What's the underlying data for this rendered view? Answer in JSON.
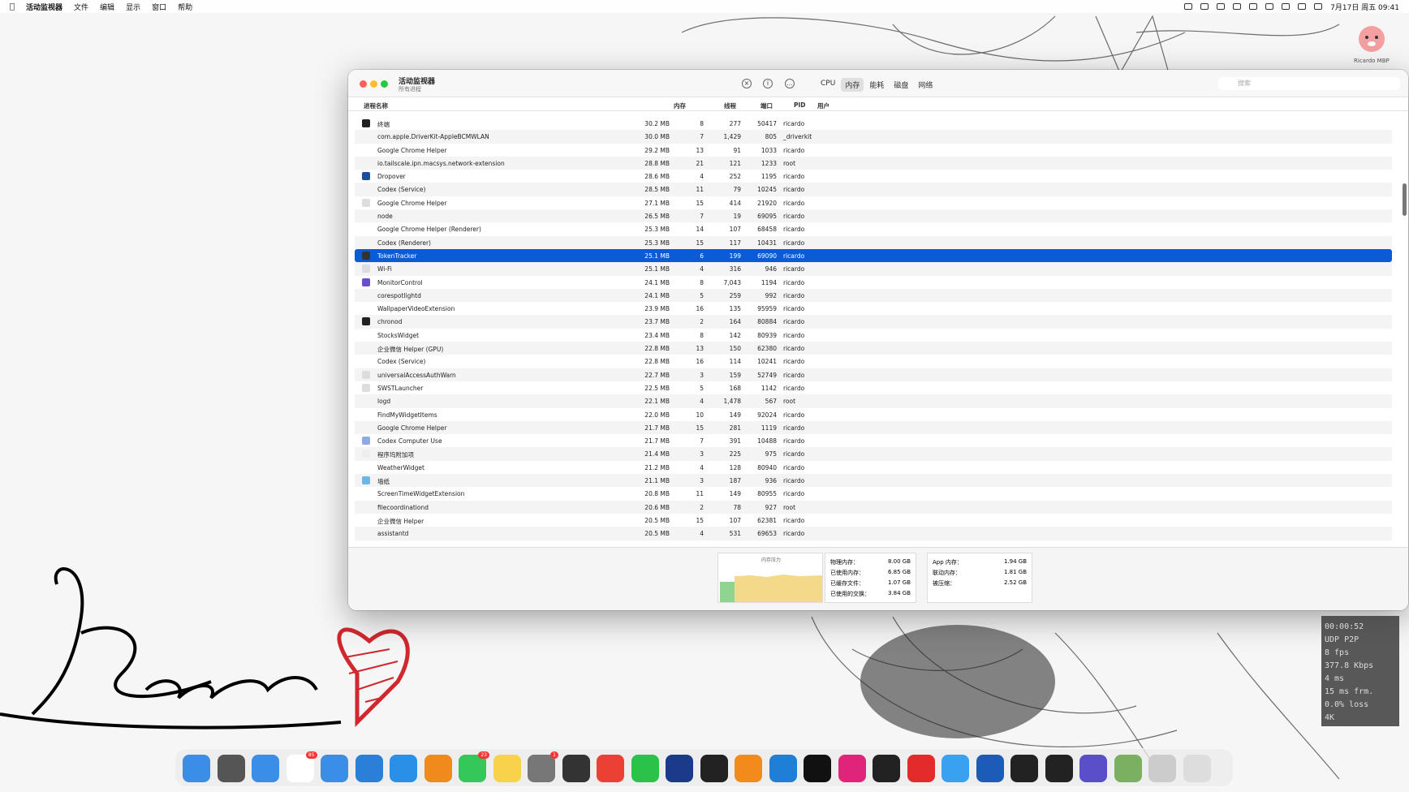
{
  "menubar": {
    "app_name": "活动监视器",
    "items": [
      "文件",
      "编辑",
      "显示",
      "窗口",
      "帮助"
    ],
    "datetime": "7月17日 周五 09:41"
  },
  "avatar_label": "Ricardo MBP",
  "window": {
    "title": "活动监视器",
    "subtitle": "所有进程",
    "tabs": [
      "CPU",
      "内存",
      "能耗",
      "磁盘",
      "网络"
    ],
    "active_tab": "内存",
    "search_placeholder": "搜索",
    "columns": {
      "name": "进程名称",
      "mem": "内存",
      "threads": "线程",
      "ports": "端口",
      "pid": "PID",
      "user": "用户"
    }
  },
  "rows": [
    {
      "name": "终端",
      "mem": "30.2 MB",
      "threads": "8",
      "ports": "277",
      "pid": "50417",
      "user": "ricardo",
      "icon": "#222"
    },
    {
      "name": "com.apple.DriverKit-AppleBCMWLAN",
      "mem": "30.0 MB",
      "threads": "7",
      "ports": "1,429",
      "pid": "805",
      "user": "_driverkit",
      "icon": ""
    },
    {
      "name": "Google Chrome Helper",
      "mem": "29.2 MB",
      "threads": "13",
      "ports": "91",
      "pid": "1033",
      "user": "ricardo",
      "icon": ""
    },
    {
      "name": "io.tailscale.ipn.macsys.network-extension",
      "mem": "28.8 MB",
      "threads": "21",
      "ports": "121",
      "pid": "1233",
      "user": "root",
      "icon": ""
    },
    {
      "name": "Dropover",
      "mem": "28.6 MB",
      "threads": "4",
      "ports": "252",
      "pid": "1195",
      "user": "ricardo",
      "icon": "#1a4fa0"
    },
    {
      "name": "Codex (Service)",
      "mem": "28.5 MB",
      "threads": "11",
      "ports": "79",
      "pid": "10245",
      "user": "ricardo",
      "icon": ""
    },
    {
      "name": "Google Chrome Helper",
      "mem": "27.1 MB",
      "threads": "15",
      "ports": "414",
      "pid": "21920",
      "user": "ricardo",
      "icon": "#ddd"
    },
    {
      "name": "node",
      "mem": "26.5 MB",
      "threads": "7",
      "ports": "19",
      "pid": "69095",
      "user": "ricardo",
      "icon": ""
    },
    {
      "name": "Google Chrome Helper (Renderer)",
      "mem": "25.3 MB",
      "threads": "14",
      "ports": "107",
      "pid": "68458",
      "user": "ricardo",
      "icon": ""
    },
    {
      "name": "Codex (Renderer)",
      "mem": "25.3 MB",
      "threads": "15",
      "ports": "117",
      "pid": "10431",
      "user": "ricardo",
      "icon": ""
    },
    {
      "name": "TokenTracker",
      "mem": "25.1 MB",
      "threads": "6",
      "ports": "199",
      "pid": "69090",
      "user": "ricardo",
      "icon": "#333",
      "selected": true
    },
    {
      "name": "Wi-Fi",
      "mem": "25.1 MB",
      "threads": "4",
      "ports": "316",
      "pid": "946",
      "user": "ricardo",
      "icon": "#ddd"
    },
    {
      "name": "MonitorControl",
      "mem": "24.1 MB",
      "threads": "8",
      "ports": "7,043",
      "pid": "1194",
      "user": "ricardo",
      "icon": "#6a4fc8"
    },
    {
      "name": "corespotlightd",
      "mem": "24.1 MB",
      "threads": "5",
      "ports": "259",
      "pid": "992",
      "user": "ricardo",
      "icon": ""
    },
    {
      "name": "WallpaperVideoExtension",
      "mem": "23.9 MB",
      "threads": "16",
      "ports": "135",
      "pid": "95959",
      "user": "ricardo",
      "icon": ""
    },
    {
      "name": "chronod",
      "mem": "23.7 MB",
      "threads": "2",
      "ports": "164",
      "pid": "80884",
      "user": "ricardo",
      "icon": "#222"
    },
    {
      "name": "StocksWidget",
      "mem": "23.4 MB",
      "threads": "8",
      "ports": "142",
      "pid": "80939",
      "user": "ricardo",
      "icon": ""
    },
    {
      "name": "企业微信 Helper (GPU)",
      "mem": "22.8 MB",
      "threads": "13",
      "ports": "150",
      "pid": "62380",
      "user": "ricardo",
      "icon": ""
    },
    {
      "name": "Codex (Service)",
      "mem": "22.8 MB",
      "threads": "16",
      "ports": "114",
      "pid": "10241",
      "user": "ricardo",
      "icon": ""
    },
    {
      "name": "universalAccessAuthWarn",
      "mem": "22.7 MB",
      "threads": "3",
      "ports": "159",
      "pid": "52749",
      "user": "ricardo",
      "icon": "#ddd"
    },
    {
      "name": "SWSTLauncher",
      "mem": "22.5 MB",
      "threads": "5",
      "ports": "168",
      "pid": "1142",
      "user": "ricardo",
      "icon": "#ddd"
    },
    {
      "name": "logd",
      "mem": "22.1 MB",
      "threads": "4",
      "ports": "1,478",
      "pid": "567",
      "user": "root",
      "icon": ""
    },
    {
      "name": "FindMyWidgetItems",
      "mem": "22.0 MB",
      "threads": "10",
      "ports": "149",
      "pid": "92024",
      "user": "ricardo",
      "icon": ""
    },
    {
      "name": "Google Chrome Helper",
      "mem": "21.7 MB",
      "threads": "15",
      "ports": "281",
      "pid": "1119",
      "user": "ricardo",
      "icon": ""
    },
    {
      "name": "Codex Computer Use",
      "mem": "21.7 MB",
      "threads": "7",
      "ports": "391",
      "pid": "10488",
      "user": "ricardo",
      "icon": "#8fa8e8"
    },
    {
      "name": "程序坞附加项",
      "mem": "21.4 MB",
      "threads": "3",
      "ports": "225",
      "pid": "975",
      "user": "ricardo",
      "icon": "#eee"
    },
    {
      "name": "WeatherWidget",
      "mem": "21.2 MB",
      "threads": "4",
      "ports": "128",
      "pid": "80940",
      "user": "ricardo",
      "icon": ""
    },
    {
      "name": "墙纸",
      "mem": "21.1 MB",
      "threads": "3",
      "ports": "187",
      "pid": "936",
      "user": "ricardo",
      "icon": "#6bb8e8"
    },
    {
      "name": "ScreenTimeWidgetExtension",
      "mem": "20.8 MB",
      "threads": "11",
      "ports": "149",
      "pid": "80955",
      "user": "ricardo",
      "icon": ""
    },
    {
      "name": "filecoordinationd",
      "mem": "20.6 MB",
      "threads": "2",
      "ports": "78",
      "pid": "927",
      "user": "root",
      "icon": ""
    },
    {
      "name": "企业微信 Helper",
      "mem": "20.5 MB",
      "threads": "15",
      "ports": "107",
      "pid": "62381",
      "user": "ricardo",
      "icon": ""
    },
    {
      "name": "assistantd",
      "mem": "20.5 MB",
      "threads": "4",
      "ports": "531",
      "pid": "69653",
      "user": "ricardo",
      "icon": ""
    }
  ],
  "bottom": {
    "pressure_label": "内存压力",
    "stats1": [
      {
        "label": "物理内存：",
        "value": "8.00 GB"
      },
      {
        "label": "已使用内存：",
        "value": "6.85 GB"
      },
      {
        "label": "已缓存文件：",
        "value": "1.07 GB"
      },
      {
        "label": "已使用的交换：",
        "value": "3.84 GB"
      }
    ],
    "stats2": [
      {
        "label": "App 内存：",
        "value": "1.94 GB"
      },
      {
        "label": "联动内存：",
        "value": "1.81 GB"
      },
      {
        "label": "被压缩：",
        "value": "2.52 GB"
      }
    ]
  },
  "overlay": [
    "00:00:52",
    "UDP P2P",
    "8 fps",
    "377.8 Kbps",
    "4 ms",
    "15 ms frm.",
    "0.0% loss",
    "4K"
  ],
  "dock": {
    "apps": [
      {
        "name": "finder-icon",
        "color": "#3a8ee6"
      },
      {
        "name": "launchpad-icon",
        "color": "#555"
      },
      {
        "name": "appstore-icon",
        "color": "#3a8ee6"
      },
      {
        "name": "reminders-icon",
        "color": "#fff",
        "badge": "85"
      },
      {
        "name": "mail-icon",
        "color": "#3a8ee6"
      },
      {
        "name": "icloud-icon",
        "color": "#2a7fd6"
      },
      {
        "name": "safari-icon",
        "color": "#2a8fe6"
      },
      {
        "name": "books-icon",
        "color": "#f08a1c"
      },
      {
        "name": "messages-icon",
        "color": "#34c759",
        "badge": "23"
      },
      {
        "name": "notes-icon",
        "color": "#f7d24a"
      },
      {
        "name": "settings-icon",
        "color": "#777",
        "badge": "1"
      },
      {
        "name": "iphone-mirroring-icon",
        "color": "#333"
      },
      {
        "name": "chrome-icon",
        "color": "#e94235"
      },
      {
        "name": "wechat-icon",
        "color": "#2bc24a"
      },
      {
        "name": "xcode-docs-icon",
        "color": "#1a3a8a"
      },
      {
        "name": "chatgpt-icon",
        "color": "#222"
      },
      {
        "name": "sublime-icon",
        "color": "#f28b1c"
      },
      {
        "name": "vscode-icon",
        "color": "#1f7fd6"
      },
      {
        "name": "pycharm-icon",
        "color": "#111"
      },
      {
        "name": "intellij-icon",
        "color": "#e0247a"
      },
      {
        "name": "launcher-icon",
        "color": "#222"
      },
      {
        "name": "netease-music-icon",
        "color": "#e42b2b"
      },
      {
        "name": "qq-icon",
        "color": "#3aa0f0"
      },
      {
        "name": "word-icon",
        "color": "#1d5bb8"
      },
      {
        "name": "activity-monitor-icon",
        "color": "#222"
      },
      {
        "name": "terminal-icon",
        "color": "#222"
      },
      {
        "name": "codex-icon",
        "color": "#5a4fc8"
      },
      {
        "name": "photos-stack-icon",
        "color": "#7ab060"
      },
      {
        "name": "downloads-stack-icon",
        "color": "#ccc"
      },
      {
        "name": "trash-icon",
        "color": "#ddd"
      }
    ]
  }
}
